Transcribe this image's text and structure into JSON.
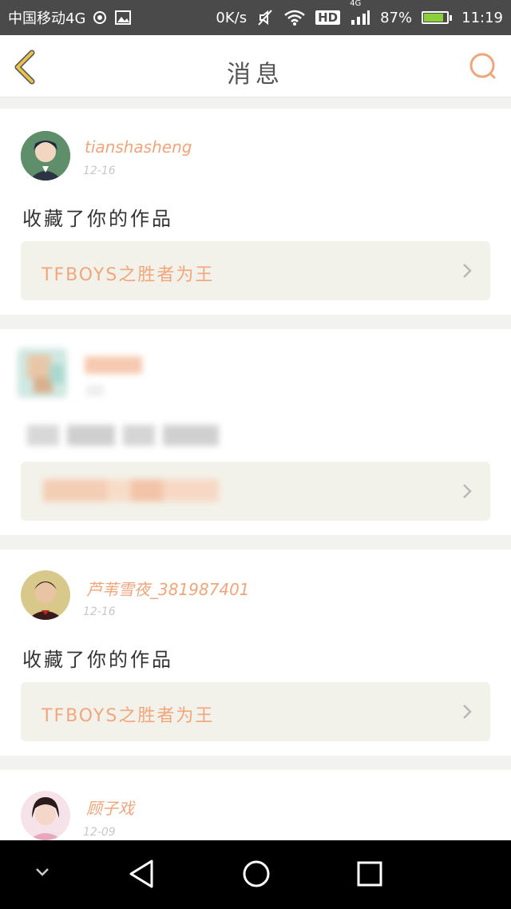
{
  "status_bar": {
    "carrier": "中国移动4G",
    "speed": "0K/s",
    "hd": "HD",
    "network": "4G",
    "battery": "87%",
    "time": "11:19",
    "battery_level": 0.87
  },
  "header": {
    "title": "消息"
  },
  "notifications": [
    {
      "username": "tianshasheng",
      "date": "12-16",
      "message": "收藏了你的作品",
      "work_title": "TFBOYS之胜者为王"
    },
    {
      "username": "",
      "date": "",
      "message": "",
      "work_title": ""
    },
    {
      "username": "芦苇雪夜_381987401",
      "date": "12-16",
      "message": "收藏了你的作品",
      "work_title": "TFBOYS之胜者为王"
    },
    {
      "username": "顾子戏",
      "date": "12-09"
    }
  ],
  "colors": {
    "accent": "#f0a57a",
    "card_link_bg": "#f3f2ea",
    "statusbar_bg": "#4a4a4a",
    "back_arrow": "#e8c24a"
  },
  "icons": {
    "back": "back-arrow-icon",
    "search": "search-icon",
    "chevron": "chevron-right-icon",
    "nav_hide": "chevron-down-icon",
    "nav_back": "triangle-back-icon",
    "nav_home": "circle-home-icon",
    "nav_recent": "square-recent-icon"
  }
}
